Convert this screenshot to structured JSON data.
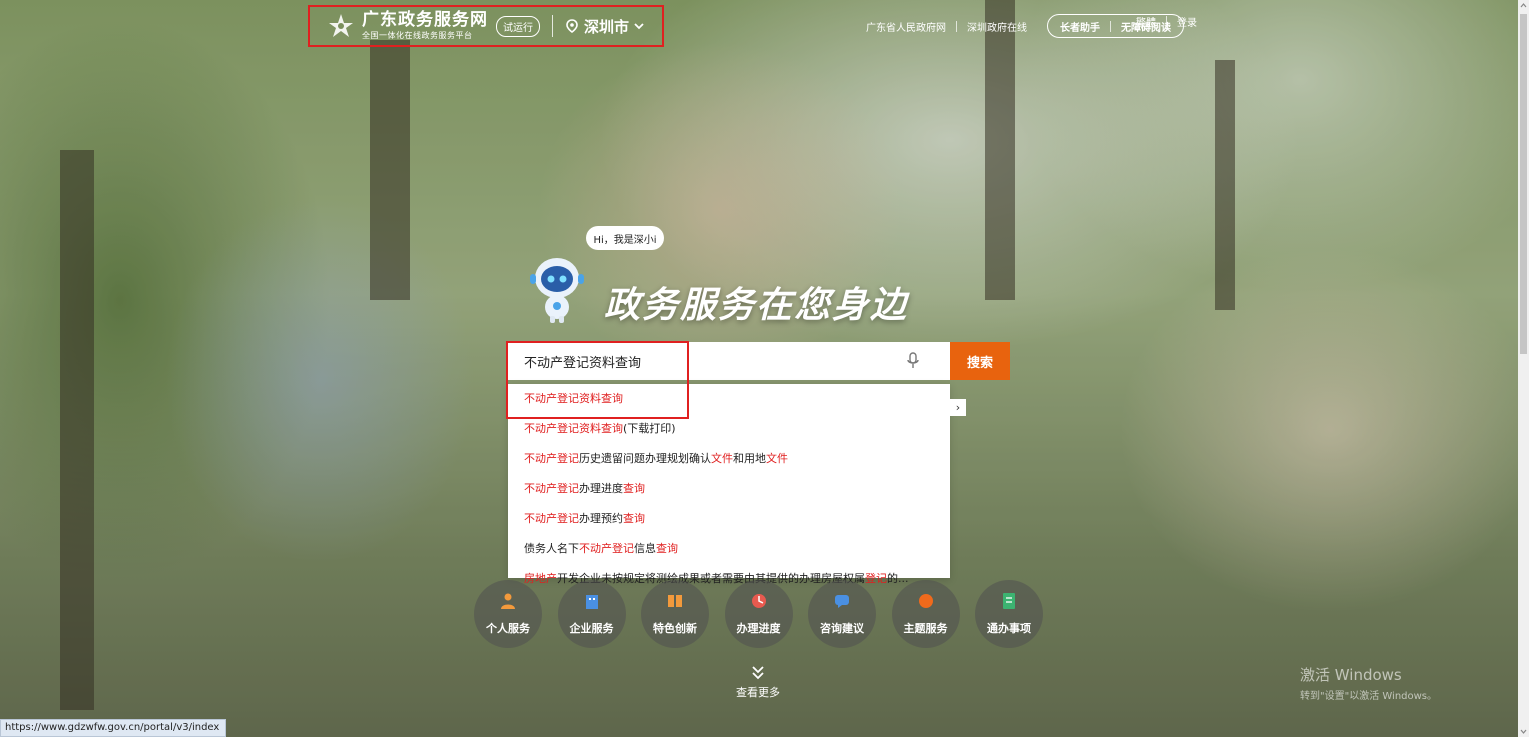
{
  "header": {
    "logo_title": "广东政务服务网",
    "logo_subtitle": "全国一体化在线政务服务平台",
    "trial_badge": "试运行",
    "city": "深圳市",
    "links": [
      "广东省人民政府网",
      "深圳政府在线"
    ],
    "elder_mode": "长者助手",
    "accessible_reading": "无障碍阅读",
    "traditional": "繁體",
    "login": "登录"
  },
  "hero": {
    "mascot_greeting": "Hi，我是深小i",
    "slogan": "政务服务在您身边"
  },
  "search": {
    "value": "不动产登记资料查询",
    "button_label": "搜索",
    "suggestions": [
      [
        {
          "t": "不动产登记资料查询",
          "r": true
        }
      ],
      [
        {
          "t": "不动产登记资料查询",
          "r": true
        },
        {
          "t": "(下载打印)",
          "r": false
        }
      ],
      [
        {
          "t": "不动产登记",
          "r": true
        },
        {
          "t": "历史遗留问题办理规划确认",
          "r": false
        },
        {
          "t": "文件",
          "r": true
        },
        {
          "t": "和用地",
          "r": false
        },
        {
          "t": "文件",
          "r": true
        }
      ],
      [
        {
          "t": "不动产登记",
          "r": true
        },
        {
          "t": "办理进度",
          "r": false
        },
        {
          "t": "查询",
          "r": true
        }
      ],
      [
        {
          "t": "不动产登记",
          "r": true
        },
        {
          "t": "办理预约",
          "r": false
        },
        {
          "t": "查询",
          "r": true
        }
      ],
      [
        {
          "t": "债务人名下",
          "r": false
        },
        {
          "t": "不动产登记",
          "r": true
        },
        {
          "t": "信息",
          "r": false
        },
        {
          "t": "查询",
          "r": true
        }
      ],
      [
        {
          "t": "房地产",
          "r": true
        },
        {
          "t": "开发企业未按规定将测绘成果或者需要由其提供的办理房屋权属",
          "r": false
        },
        {
          "t": "登记",
          "r": true
        },
        {
          "t": "的...",
          "r": false
        }
      ]
    ]
  },
  "services": [
    {
      "label": "个人服务",
      "icon": "person-icon"
    },
    {
      "label": "企业服务",
      "icon": "building-icon"
    },
    {
      "label": "特色创新",
      "icon": "innovation-icon"
    },
    {
      "label": "办理进度",
      "icon": "progress-icon"
    },
    {
      "label": "咨询建议",
      "icon": "chat-icon"
    },
    {
      "label": "主题服务",
      "icon": "theme-icon"
    },
    {
      "label": "通办事项",
      "icon": "document-icon"
    }
  ],
  "more_label": "查看更多",
  "status_url": "https://www.gdzwfw.gov.cn/portal/v3/index",
  "watermark": {
    "title": "激活 Windows",
    "subtitle": "转到\"设置\"以激活 Windows。"
  },
  "colors": {
    "accent": "#e8630e",
    "highlight_red": "#e02020"
  }
}
